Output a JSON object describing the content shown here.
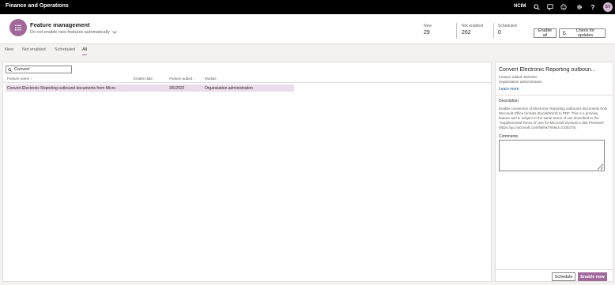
{
  "app": {
    "title": "Finance and Operations",
    "company": "NCIM",
    "user_initials": "SV"
  },
  "header": {
    "title": "Feature management",
    "subtitle": "Do not enable new features automatically",
    "stats": [
      {
        "label": "New",
        "value": "29"
      },
      {
        "label": "Not enabled",
        "value": "262"
      },
      {
        "label": "Scheduled",
        "value": "0"
      }
    ],
    "enable_all_label": "Enable all",
    "check_updates_label": "Check for updates"
  },
  "tabs": [
    "New",
    "Not enabled",
    "Scheduled",
    "All"
  ],
  "active_tab": "All",
  "grid": {
    "filter_value": "Convert",
    "columns": [
      "Feature name",
      "Enable date",
      "Feature added",
      "Module"
    ],
    "rows": [
      {
        "name": "Convert Electronic Reporting outbound documents from Micro",
        "enable_date": "",
        "added": "3/5/2020",
        "module": "Organisation administration"
      }
    ]
  },
  "details": {
    "title": "Convert Electronic Reporting outboun...",
    "feature_added": "Feature added 3/5/2020",
    "module": "Organisation administration",
    "learn_more": "Learn more",
    "description_label": "Description",
    "description": "Enable conversion of Electronic Reporting outbound documents from Microsoft Office formats (Excel/Word) to PDF. This is a preview feature and is subject to the same terms of use described in the \"Supplemental Terms of Use for Microsoft Dynamics 365 Previews\" (https://go.microsoft.com/fwlink/?linkid=2105274).",
    "comments_label": "Comments",
    "schedule_label": "Schedule",
    "enable_now_label": "Enable now"
  },
  "colors": {
    "accent": "#a2679b",
    "selected_row": "#ecdceb",
    "topbar": "#000000"
  }
}
